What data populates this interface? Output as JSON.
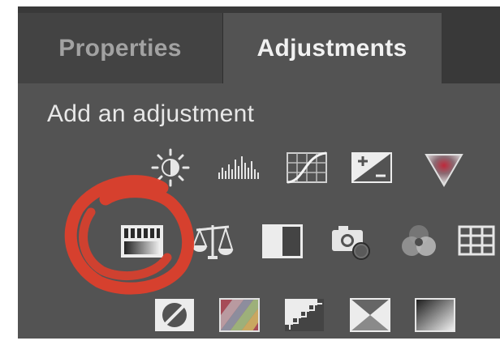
{
  "tabs": {
    "properties": "Properties",
    "adjustments": "Adjustments"
  },
  "heading": "Add an adjustment",
  "icons": [
    "brightness-contrast-icon",
    "levels-icon",
    "curves-icon",
    "exposure-icon",
    "vibrance-icon",
    "hue-saturation-icon",
    "color-balance-icon",
    "black-white-icon",
    "photo-filter-icon",
    "channel-mixer-icon",
    "color-lookup-icon",
    "invert-icon",
    "posterize-icon",
    "threshold-icon",
    "selective-color-icon",
    "gradient-map-icon"
  ],
  "annotation": {
    "type": "red-hand-drawn-circle",
    "highlighted_icon": "hue-saturation-icon",
    "color": "#dd3f2c"
  },
  "colors": {
    "panel_bg": "#535353",
    "tabbar_bg": "#393939",
    "inactive_tab_bg": "#434343",
    "icon_light": "#e6e6e6"
  }
}
